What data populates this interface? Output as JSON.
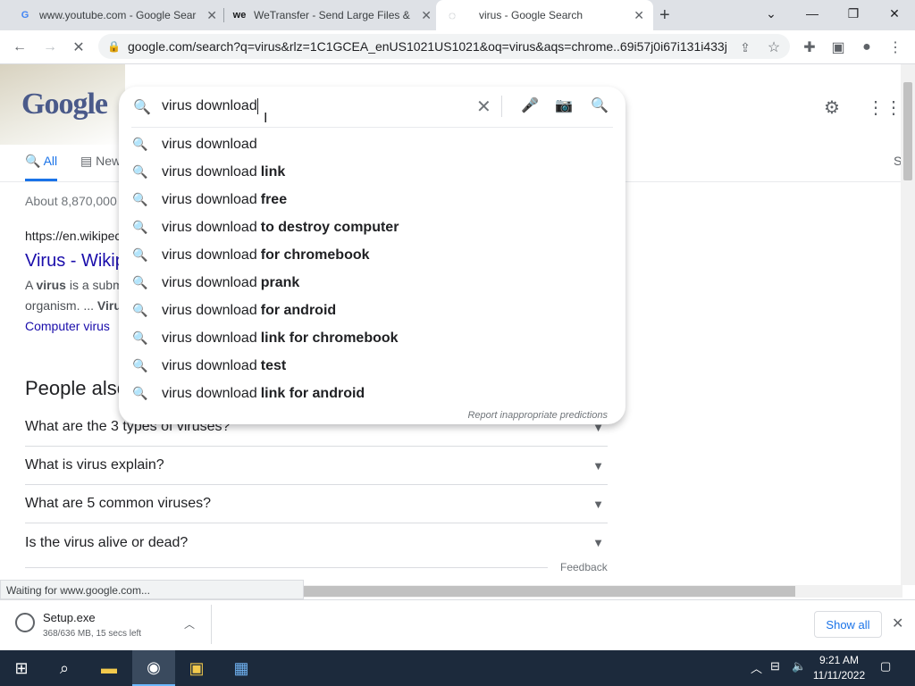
{
  "tabs": [
    {
      "title": "www.youtube.com - Google Sear",
      "favicon": "G"
    },
    {
      "title": "WeTransfer - Send Large Files &",
      "favicon": "we"
    },
    {
      "title": "virus - Google Search",
      "favicon": "loading"
    }
  ],
  "new_tab": "+",
  "omnibox": {
    "url": "google.com/search?q=virus&rlz=1C1GCEA_enUS1021US1021&oq=virus&aqs=chrome..69i57j0i67i131i433j..."
  },
  "search": {
    "query": "virus download",
    "suggestions": [
      {
        "prefix": "virus download",
        "bold": ""
      },
      {
        "prefix": "virus download",
        "bold": "link"
      },
      {
        "prefix": "virus download",
        "bold": "free"
      },
      {
        "prefix": "virus download",
        "bold": "to destroy computer"
      },
      {
        "prefix": "virus download",
        "bold": "for chromebook"
      },
      {
        "prefix": "virus download",
        "bold": "prank"
      },
      {
        "prefix": "virus download",
        "bold": "for android"
      },
      {
        "prefix": "virus download",
        "bold": "link for chromebook"
      },
      {
        "prefix": "virus download",
        "bold": "test"
      },
      {
        "prefix": "virus download",
        "bold": "link for android"
      }
    ],
    "report": "Report inappropriate predictions"
  },
  "logo": "Google",
  "results_tabs": {
    "all": "All",
    "news": "New",
    "right": "S"
  },
  "results": {
    "stats": "About 8,870,000",
    "url": "https://en.wikipec",
    "title": "Virus - Wikip",
    "snippet_1a": "A ",
    "snippet_1b": "virus",
    "snippet_1c": " is a subm",
    "snippet_2a": "organism. ... ",
    "snippet_2b": "Viru",
    "link": "Computer virus"
  },
  "paa": {
    "heading": "People also",
    "questions": [
      "What are the 3 types of viruses?",
      "What is virus explain?",
      "What are 5 common viruses?",
      "Is the virus alive or dead?"
    ],
    "feedback": "Feedback"
  },
  "status": "Waiting for www.google.com...",
  "download": {
    "name": "Setup.exe",
    "progress": "368/636 MB, 15 secs left",
    "show_all": "Show all"
  },
  "clock": {
    "time": "9:21 AM",
    "date": "11/11/2022"
  },
  "colors": {
    "link": "#1a0dab",
    "accent": "#1a73e8",
    "taskbar": "#1c2a3c"
  }
}
